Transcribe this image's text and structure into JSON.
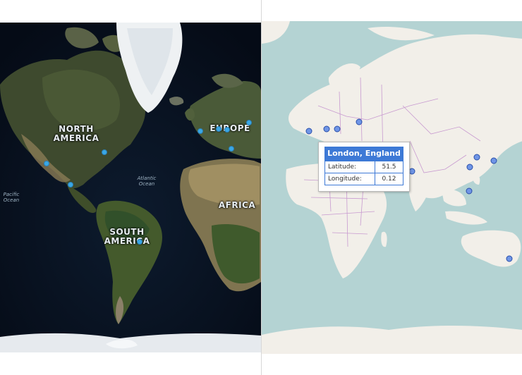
{
  "left_map": {
    "style": "aerial",
    "labels": {
      "north_america": "NORTH AMERICA",
      "europe": "EUROPE",
      "africa": "AFRICA",
      "south_america": "SOUTH AMERICA",
      "atlantic": "Atlantic Ocean",
      "pacific": "Pacific Ocean"
    },
    "marker_color": "#3aa8e6"
  },
  "right_map": {
    "style": "road",
    "marker_color": "#6f95e6"
  },
  "info_box": {
    "title": "London, England",
    "rows": [
      {
        "label": "Latitude:",
        "value": "51.5"
      },
      {
        "label": "Longitude:",
        "value": "0.12"
      }
    ],
    "header_color": "#3d79d6"
  }
}
